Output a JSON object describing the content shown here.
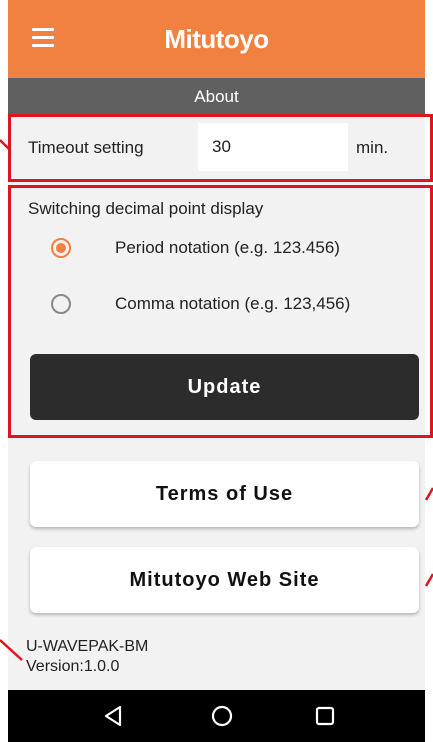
{
  "header": {
    "brand": "Mitutoyo",
    "menu_icon": "hamburger-menu-icon",
    "subtitle": "About"
  },
  "timeout": {
    "label": "Timeout setting",
    "value": "30",
    "unit": "min."
  },
  "decimal_display": {
    "title": "Switching decimal point display",
    "options": [
      {
        "label": "Period notation (e.g. 123.456)",
        "selected": true
      },
      {
        "label": "Comma notation (e.g. 123,456)",
        "selected": false
      }
    ],
    "update_label": "Update"
  },
  "links": {
    "terms_label": "Terms of Use",
    "website_label": "Mitutoyo Web Site"
  },
  "app_info": {
    "name": "U-WAVEPAK-BM",
    "version": "Version:1.0.0"
  },
  "nav": {
    "back_icon": "back-triangle-icon",
    "home_icon": "home-circle-icon",
    "recent_icon": "recent-apps-square-icon"
  },
  "colors": {
    "accent": "#f08141",
    "subbar": "#606060",
    "update_button": "#2c2c2c",
    "highlight": "#e0141c",
    "background": "#f2f2f2"
  }
}
